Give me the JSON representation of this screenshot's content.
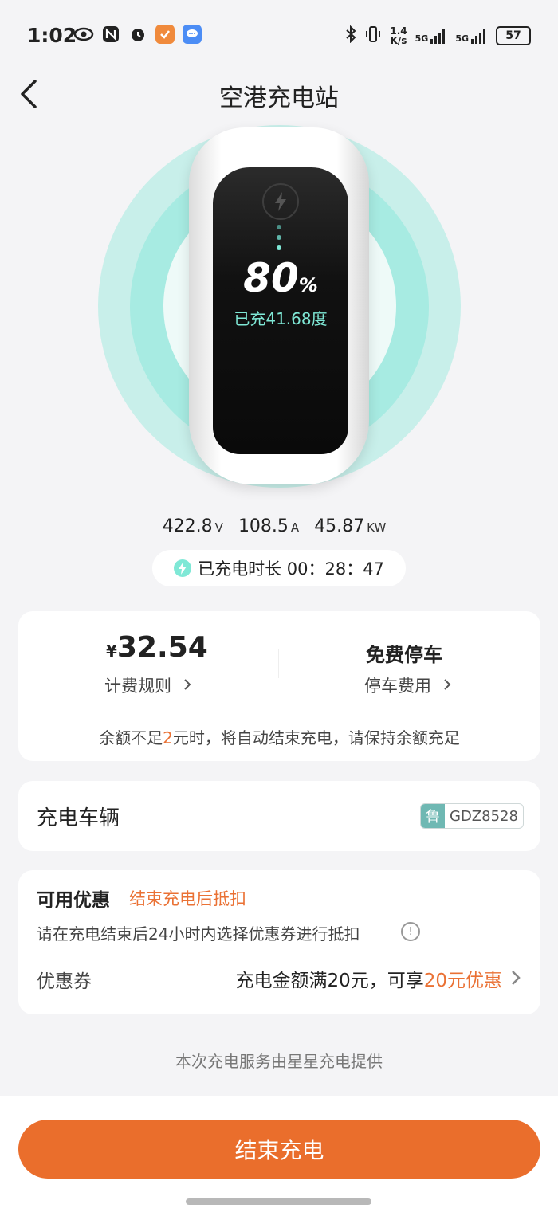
{
  "status_bar": {
    "time": "1:02",
    "net_speed_value": "1.4",
    "net_speed_unit": "K/s",
    "signal1": "5G",
    "signal2": "5G",
    "battery": "57"
  },
  "header": {
    "title": "空港充电站"
  },
  "charging": {
    "percent": "80",
    "percent_sign": "%",
    "charged_text": "已充41.68度",
    "voltage": "422.8",
    "voltage_unit": "V",
    "current": "108.5",
    "current_unit": "A",
    "power": "45.87",
    "power_unit": "KW",
    "duration_label": "已充电时长 00：28：47"
  },
  "fee_card": {
    "currency": "¥",
    "amount": "32.54",
    "fee_rule_label": "计费规则",
    "parking_title": "免费停车",
    "parking_fee_label": "停车费用",
    "notice_prefix": "余额不足",
    "notice_amount": "2",
    "notice_suffix": "元时，将自动结束充电，请保持余额充足"
  },
  "vehicle_card": {
    "label": "充电车辆",
    "plate_province": "鲁",
    "plate_number": "GDZ8528"
  },
  "coupon_card": {
    "title": "可用优惠",
    "subtitle": "结束充电后抵扣",
    "hint": "请在充电结束后24小时内选择优惠券进行抵扣",
    "coupon_label": "优惠券",
    "coupon_value_prefix": "充电金额满20元，可享",
    "coupon_value_highlight": "20元优惠"
  },
  "footer": {
    "provider_text": "本次充电服务由星星充电提供",
    "end_button_label": "结束充电"
  },
  "colors": {
    "accent_orange": "#ea6e2c",
    "teal": "#7fe8d6",
    "background": "#f4f4f6"
  }
}
